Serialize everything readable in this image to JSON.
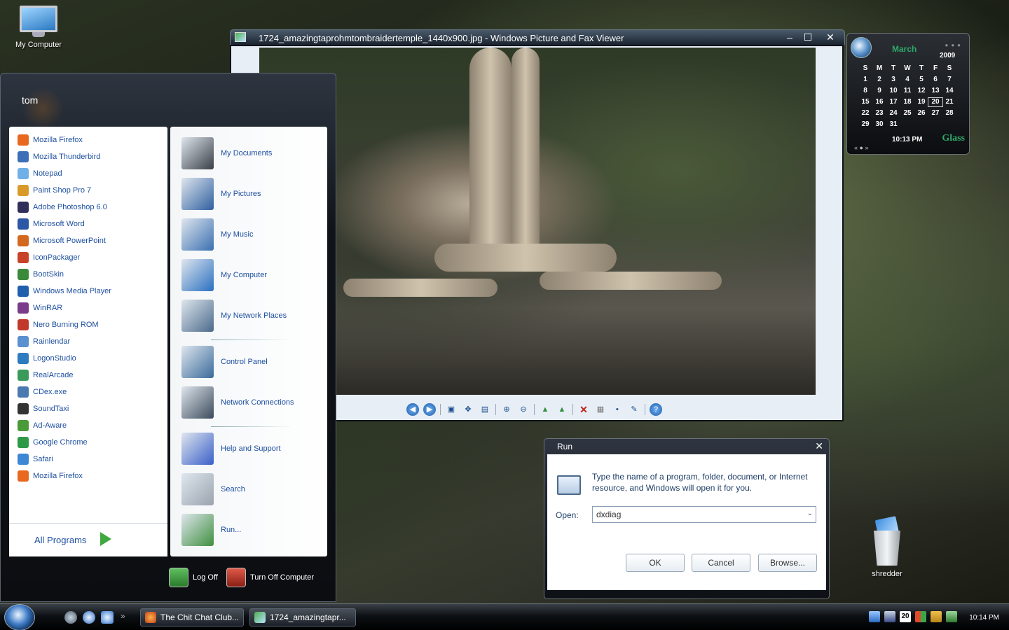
{
  "desktop": {
    "my_computer_label": "My Computer",
    "shredder_label": "shredder"
  },
  "viewer": {
    "title": "1724_amazingtaprohmtombraidertemple_1440x900.jpg - Windows Picture and Fax Viewer",
    "toolbar_icons": [
      "previous-image-icon",
      "next-image-icon",
      "best-fit-icon",
      "actual-size-icon",
      "slideshow-icon",
      "zoom-in-icon",
      "zoom-out-icon",
      "rotate-clockwise-icon",
      "rotate-counterclockwise-icon",
      "delete-icon",
      "print-icon",
      "save-icon",
      "edit-icon",
      "help-icon"
    ]
  },
  "calendar": {
    "month": "March",
    "year": "2009",
    "weekdays": [
      "S",
      "M",
      "T",
      "W",
      "T",
      "F",
      "S"
    ],
    "days": [
      "1",
      "2",
      "3",
      "4",
      "5",
      "6",
      "7",
      "8",
      "9",
      "10",
      "11",
      "12",
      "13",
      "14",
      "15",
      "16",
      "17",
      "18",
      "19",
      "20",
      "21",
      "22",
      "23",
      "24",
      "25",
      "26",
      "27",
      "28",
      "29",
      "30",
      "31"
    ],
    "today": "20",
    "time": "10:13 PM",
    "nav": "«  ●  »",
    "brand": "Glass"
  },
  "start_menu": {
    "user": "tom",
    "programs": [
      {
        "name": "Mozilla Firefox",
        "color": "#e8681f"
      },
      {
        "name": "Mozilla Thunderbird",
        "color": "#3d6fb8"
      },
      {
        "name": "Notepad",
        "color": "#6fb0e8"
      },
      {
        "name": "Paint Shop Pro 7",
        "color": "#d99a2a"
      },
      {
        "name": "Adobe Photoshop 6.0",
        "color": "#2f2f5a"
      },
      {
        "name": "Microsoft Word",
        "color": "#2b57a6"
      },
      {
        "name": "Microsoft PowerPoint",
        "color": "#d2691e"
      },
      {
        "name": "IconPackager",
        "color": "#c8422a"
      },
      {
        "name": "BootSkin",
        "color": "#3b8a3b"
      },
      {
        "name": "Windows Media Player",
        "color": "#1f5fae"
      },
      {
        "name": "WinRAR",
        "color": "#7a3b8a"
      },
      {
        "name": "Nero Burning ROM",
        "color": "#c0392b"
      },
      {
        "name": "Rainlendar",
        "color": "#5a8fd0"
      },
      {
        "name": "LogonStudio",
        "color": "#2e7bbf"
      },
      {
        "name": "RealArcade",
        "color": "#3a9a5a"
      },
      {
        "name": "CDex.exe",
        "color": "#4a7ab0"
      },
      {
        "name": "SoundTaxi",
        "color": "#333333"
      },
      {
        "name": "Ad-Aware",
        "color": "#4b9a3a"
      },
      {
        "name": "Google Chrome",
        "color": "#2f9a45"
      },
      {
        "name": "Safari",
        "color": "#3c88d4"
      },
      {
        "name": "Mozilla Firefox",
        "color": "#e8681f"
      }
    ],
    "all_programs": "All Programs",
    "places": [
      {
        "name": "My Documents",
        "color": "#3a3f46"
      },
      {
        "name": "My Pictures",
        "color": "#2f5f9f"
      },
      {
        "name": "My Music",
        "color": "#3a6fb0"
      },
      {
        "name": "My Computer",
        "color": "#2a6fc0"
      },
      {
        "name": "My Network Places",
        "color": "#4a6a8a"
      },
      {
        "name": "Control Panel",
        "color": "#3a6a9a"
      },
      {
        "name": "Network Connections",
        "color": "#3a4a5a"
      },
      {
        "name": "Help and Support",
        "color": "#3a5fc8"
      },
      {
        "name": "Search",
        "color": "#9aa4ae"
      },
      {
        "name": "Run...",
        "color": "#3f8f3f"
      }
    ],
    "log_off": "Log Off",
    "turn_off": "Turn Off Computer"
  },
  "run_dialog": {
    "title": "Run",
    "description": "Type the name of a program, folder, document, or Internet resource, and Windows will open it for you.",
    "open_label": "Open:",
    "open_value": "dxdiag",
    "ok": "OK",
    "cancel": "Cancel",
    "browse": "Browse..."
  },
  "taskbar": {
    "tasks": [
      "The Chit Chat Club...",
      "1724_amazingtapr..."
    ],
    "tray_date": "20",
    "clock": "10:14 PM"
  }
}
